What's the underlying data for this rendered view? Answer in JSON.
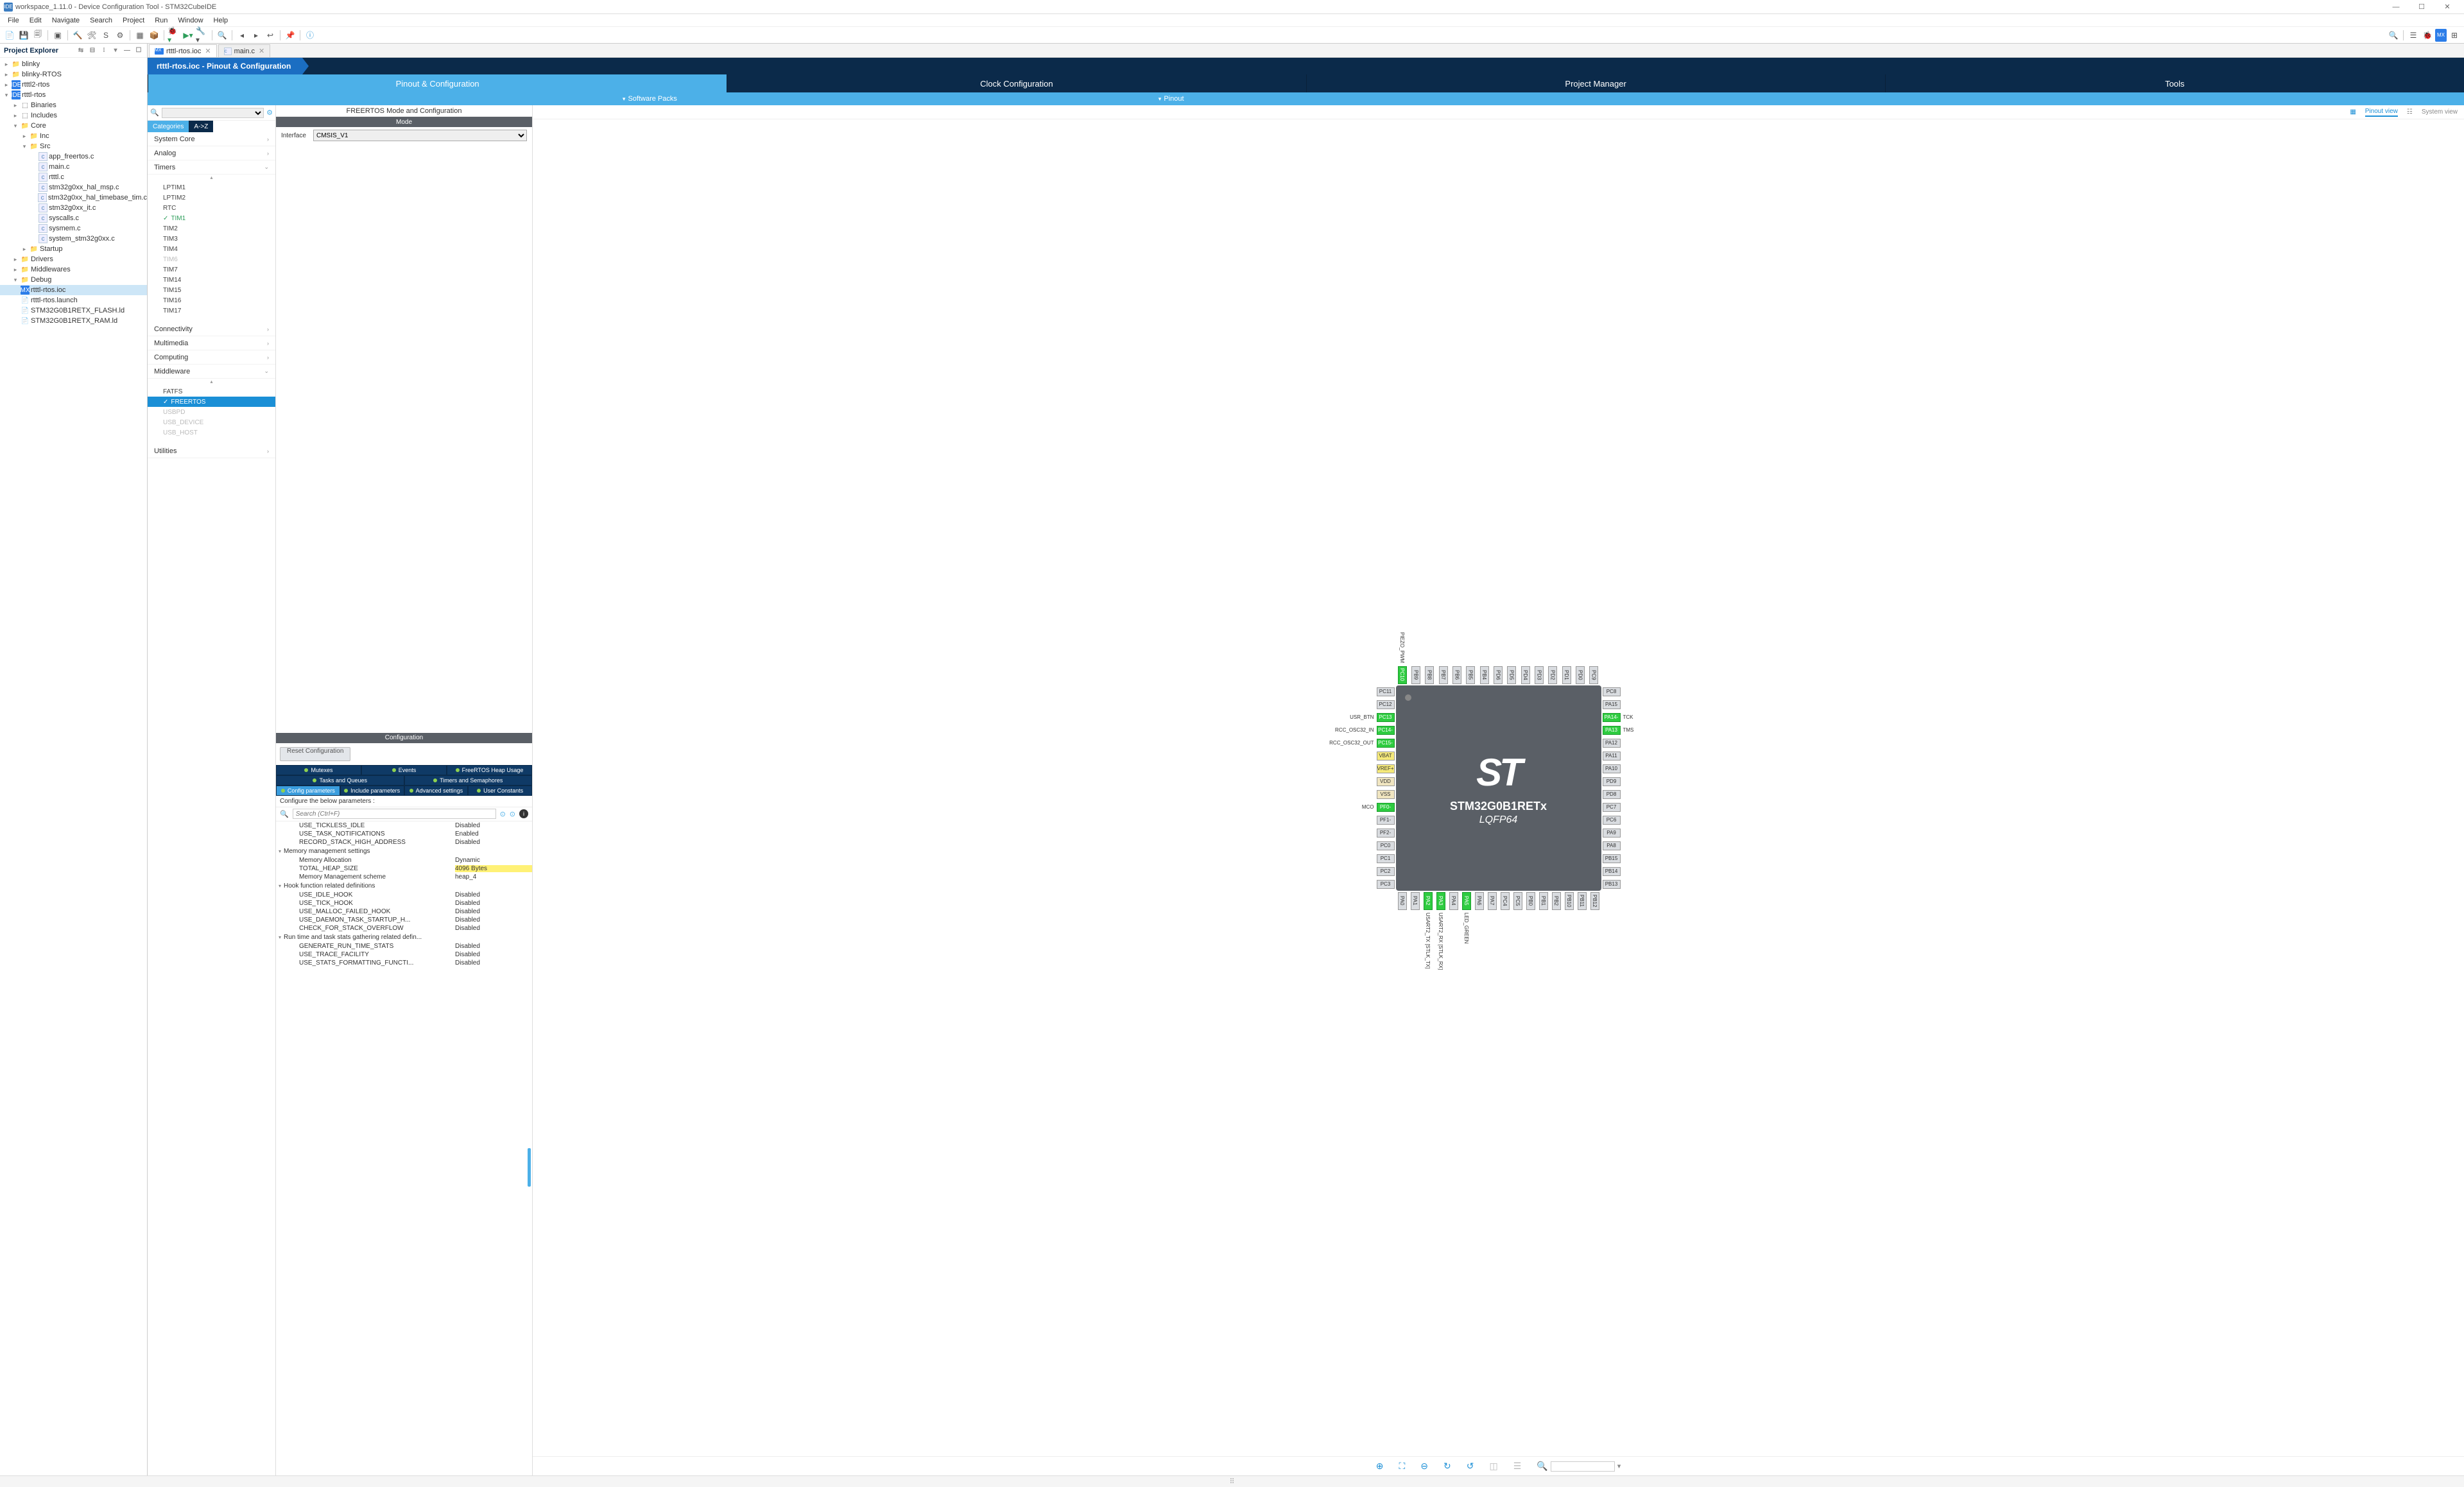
{
  "window": {
    "title": "workspace_1.11.0 - Device Configuration Tool - STM32CubeIDE",
    "min": "—",
    "max": "☐",
    "close": "✕"
  },
  "menu": [
    "File",
    "Edit",
    "Navigate",
    "Search",
    "Project",
    "Run",
    "Window",
    "Help"
  ],
  "explorer": {
    "title": "Project Explorer",
    "items": [
      {
        "d": 0,
        "t": "folder",
        "l": "blinky",
        "exp": false
      },
      {
        "d": 0,
        "t": "folder",
        "l": "blinky-RTOS",
        "exp": false
      },
      {
        "d": 0,
        "t": "ide",
        "l": "rtttl2-rtos",
        "exp": false
      },
      {
        "d": 0,
        "t": "ide",
        "l": "rtttl-rtos",
        "exp": true
      },
      {
        "d": 1,
        "t": "bin",
        "l": "Binaries",
        "exp": false
      },
      {
        "d": 1,
        "t": "inc",
        "l": "Includes",
        "exp": false
      },
      {
        "d": 1,
        "t": "folder",
        "l": "Core",
        "exp": true
      },
      {
        "d": 2,
        "t": "folder",
        "l": "Inc",
        "exp": false
      },
      {
        "d": 2,
        "t": "folder",
        "l": "Src",
        "exp": true
      },
      {
        "d": 3,
        "t": "c",
        "l": "app_freertos.c"
      },
      {
        "d": 3,
        "t": "c",
        "l": "main.c"
      },
      {
        "d": 3,
        "t": "c",
        "l": "rtttl.c"
      },
      {
        "d": 3,
        "t": "c",
        "l": "stm32g0xx_hal_msp.c"
      },
      {
        "d": 3,
        "t": "c",
        "l": "stm32g0xx_hal_timebase_tim.c"
      },
      {
        "d": 3,
        "t": "c",
        "l": "stm32g0xx_it.c"
      },
      {
        "d": 3,
        "t": "c",
        "l": "syscalls.c"
      },
      {
        "d": 3,
        "t": "c",
        "l": "sysmem.c"
      },
      {
        "d": 3,
        "t": "c",
        "l": "system_stm32g0xx.c"
      },
      {
        "d": 2,
        "t": "folder",
        "l": "Startup",
        "exp": false
      },
      {
        "d": 1,
        "t": "folder",
        "l": "Drivers",
        "exp": false
      },
      {
        "d": 1,
        "t": "folder",
        "l": "Middlewares",
        "exp": false
      },
      {
        "d": 1,
        "t": "folder",
        "l": "Debug",
        "exp": true
      },
      {
        "d": 1,
        "t": "mx",
        "l": "rtttl-rtos.ioc",
        "sel": true
      },
      {
        "d": 1,
        "t": "file",
        "l": "rtttl-rtos.launch"
      },
      {
        "d": 1,
        "t": "file",
        "l": "STM32G0B1RETX_FLASH.ld"
      },
      {
        "d": 1,
        "t": "file",
        "l": "STM32G0B1RETX_RAM.ld"
      }
    ]
  },
  "editorTabs": [
    {
      "label": "rtttl-rtos.ioc",
      "active": true,
      "icon": "mx"
    },
    {
      "label": "main.c",
      "active": false,
      "icon": "c"
    }
  ],
  "crumb": "rtttl-rtos.ioc - Pinout & Configuration",
  "bigtabs": [
    "Pinout & Configuration",
    "Clock Configuration",
    "Project Manager",
    "Tools"
  ],
  "subbar": {
    "left": "Software Packs",
    "right": "Pinout"
  },
  "catTabs": {
    "a": "Categories",
    "b": "A->Z"
  },
  "catGroups": [
    {
      "name": "System Core",
      "open": false
    },
    {
      "name": "Analog",
      "open": false
    },
    {
      "name": "Timers",
      "open": true,
      "items": [
        {
          "l": "LPTIM1"
        },
        {
          "l": "LPTIM2"
        },
        {
          "l": "RTC"
        },
        {
          "l": "TIM1",
          "green": true
        },
        {
          "l": "TIM2"
        },
        {
          "l": "TIM3"
        },
        {
          "l": "TIM4"
        },
        {
          "l": "TIM6",
          "dim": true
        },
        {
          "l": "TIM7"
        },
        {
          "l": "TIM14"
        },
        {
          "l": "TIM15"
        },
        {
          "l": "TIM16"
        },
        {
          "l": "TIM17"
        }
      ]
    },
    {
      "name": "Connectivity",
      "open": false
    },
    {
      "name": "Multimedia",
      "open": false
    },
    {
      "name": "Computing",
      "open": false
    },
    {
      "name": "Middleware",
      "open": true,
      "items": [
        {
          "l": "FATFS"
        },
        {
          "l": "FREERTOS",
          "sel": true
        },
        {
          "l": "USBPD",
          "dim": true
        },
        {
          "l": "USB_DEVICE",
          "dim": true
        },
        {
          "l": "USB_HOST",
          "dim": true
        }
      ]
    },
    {
      "name": "Utilities",
      "open": false
    }
  ],
  "mid": {
    "title": "FREERTOS Mode and Configuration",
    "mode": "Mode",
    "ifaceLabel": "Interface",
    "iface": "CMSIS_V1",
    "confTitle": "Configuration",
    "reset": "Reset Configuration",
    "tabsRow1": [
      "Mutexes",
      "Events",
      "FreeRTOS Heap Usage"
    ],
    "tabsRow2": [
      "Tasks and Queues",
      "Timers and Semaphores"
    ],
    "tabsRow3": [
      "Config parameters",
      "Include parameters",
      "Advanced settings",
      "User Constants"
    ],
    "paramBar": "Configure the below parameters :",
    "searchPH": "Search (Ctrl+F)",
    "params": [
      {
        "g": null,
        "n": "USE_TICKLESS_IDLE",
        "v": "Disabled"
      },
      {
        "g": null,
        "n": "USE_TASK_NOTIFICATIONS",
        "v": "Enabled"
      },
      {
        "g": null,
        "n": "RECORD_STACK_HIGH_ADDRESS",
        "v": "Disabled"
      },
      {
        "g": "Memory management settings"
      },
      {
        "g": null,
        "n": "Memory Allocation",
        "v": "Dynamic"
      },
      {
        "g": null,
        "n": "TOTAL_HEAP_SIZE",
        "v": "4096 Bytes",
        "hl": true
      },
      {
        "g": null,
        "n": "Memory Management scheme",
        "v": "heap_4"
      },
      {
        "g": "Hook function related definitions"
      },
      {
        "g": null,
        "n": "USE_IDLE_HOOK",
        "v": "Disabled"
      },
      {
        "g": null,
        "n": "USE_TICK_HOOK",
        "v": "Disabled"
      },
      {
        "g": null,
        "n": "USE_MALLOC_FAILED_HOOK",
        "v": "Disabled"
      },
      {
        "g": null,
        "n": "USE_DAEMON_TASK_STARTUP_H...",
        "v": "Disabled"
      },
      {
        "g": null,
        "n": "CHECK_FOR_STACK_OVERFLOW",
        "v": "Disabled"
      },
      {
        "g": "Run time and task stats gathering related defin..."
      },
      {
        "g": null,
        "n": "GENERATE_RUN_TIME_STATS",
        "v": "Disabled"
      },
      {
        "g": null,
        "n": "USE_TRACE_FACILITY",
        "v": "Disabled"
      },
      {
        "g": null,
        "n": "USE_STATS_FORMATTING_FUNCTI...",
        "v": "Disabled"
      }
    ]
  },
  "pinview": {
    "pinout": "Pinout view",
    "system": "System view"
  },
  "chip": {
    "part": "STM32G0B1RETx",
    "pkg": "LQFP64",
    "logo": "ST"
  },
  "pins": {
    "top": [
      {
        "l": "PC10",
        "g": true
      },
      {
        "l": "PB9"
      },
      {
        "l": "PB8"
      },
      {
        "l": "PB7"
      },
      {
        "l": "PB6"
      },
      {
        "l": "PB5"
      },
      {
        "l": "PB4"
      },
      {
        "l": "PD6"
      },
      {
        "l": "PD5"
      },
      {
        "l": "PD4"
      },
      {
        "l": "PD3"
      },
      {
        "l": "PD2"
      },
      {
        "l": "PD1"
      },
      {
        "l": "PD0"
      },
      {
        "l": "PC9"
      }
    ],
    "topLabels": {
      "PC10": "PIEZO_PWM"
    },
    "left": [
      {
        "l": "PC11"
      },
      {
        "l": "PC12"
      },
      {
        "l": "PC13",
        "g": true,
        "lab": "USR_BTN"
      },
      {
        "l": "PC14-",
        "g": true,
        "lab": "RCC_OSC32_IN"
      },
      {
        "l": "PC15-",
        "g": true,
        "lab": "RCC_OSC32_OUT"
      },
      {
        "l": "VBAT",
        "y": true
      },
      {
        "l": "VREF+",
        "y": true
      },
      {
        "l": "VDD",
        "b": true
      },
      {
        "l": "VSS",
        "b": true
      },
      {
        "l": "PF0-",
        "g": true,
        "lab": "MCO"
      },
      {
        "l": "PF1-"
      },
      {
        "l": "PF2-"
      },
      {
        "l": "PC0"
      },
      {
        "l": "PC1"
      },
      {
        "l": "PC2"
      },
      {
        "l": "PC3"
      }
    ],
    "right": [
      {
        "l": "PC8"
      },
      {
        "l": "PA15"
      },
      {
        "l": "PA14-",
        "g": true,
        "lab": "TCK"
      },
      {
        "l": "PA13",
        "g": true,
        "lab": "TMS"
      },
      {
        "l": "PA12"
      },
      {
        "l": "PA11"
      },
      {
        "l": "PA10"
      },
      {
        "l": "PD9"
      },
      {
        "l": "PD8"
      },
      {
        "l": "PC7"
      },
      {
        "l": "PC6"
      },
      {
        "l": "PA9"
      },
      {
        "l": "PA8"
      },
      {
        "l": "PB15"
      },
      {
        "l": "PB14"
      },
      {
        "l": "PB13"
      }
    ],
    "bottom": [
      {
        "l": "PA0"
      },
      {
        "l": "PA1"
      },
      {
        "l": "PA2",
        "g": true,
        "lab": "USART2_TX [STLK_TX]"
      },
      {
        "l": "PA3",
        "g": true,
        "lab": "USART2_RX [STLK_RX]"
      },
      {
        "l": "PA4"
      },
      {
        "l": "PA5",
        "g": true,
        "lab": "LED_GREEN"
      },
      {
        "l": "PA6"
      },
      {
        "l": "PA7"
      },
      {
        "l": "PC4"
      },
      {
        "l": "PC5"
      },
      {
        "l": "PB0"
      },
      {
        "l": "PB1"
      },
      {
        "l": "PB2"
      },
      {
        "l": "PB10"
      },
      {
        "l": "PB11"
      },
      {
        "l": "PB12"
      }
    ]
  }
}
